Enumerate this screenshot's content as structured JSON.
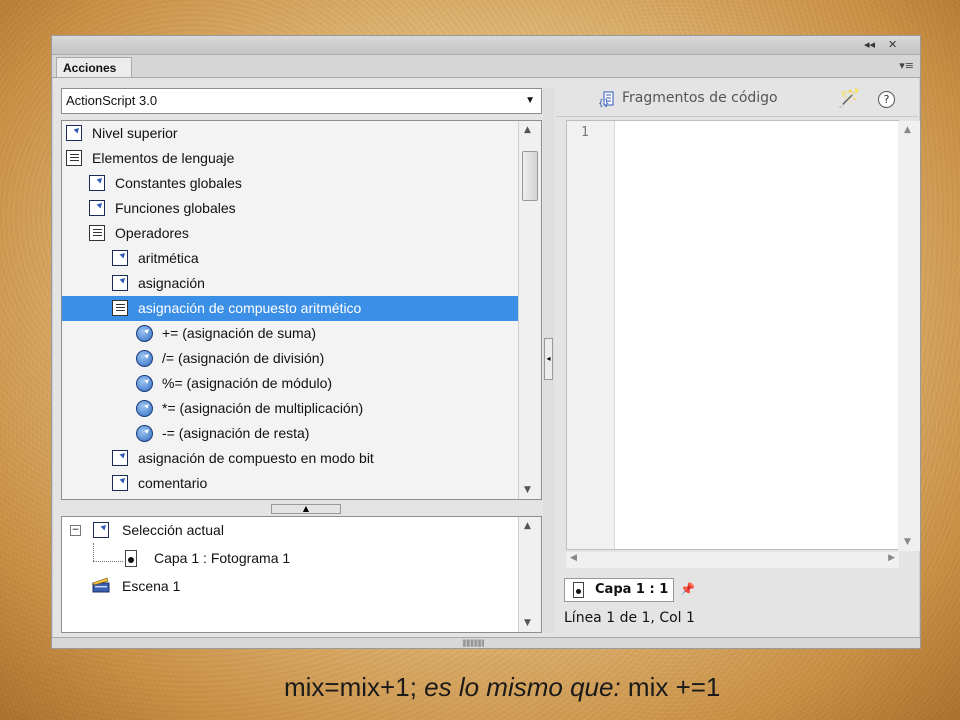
{
  "panel": {
    "tab_label": "Acciones",
    "collapse_glyph": "◂◂",
    "close_glyph": "✕",
    "menu_glyph": "▾≡"
  },
  "left": {
    "language_select": "ActionScript 3.0",
    "tree": [
      {
        "label": "Nivel superior",
        "icon": "link-icon",
        "indent": 0
      },
      {
        "label": "Elementos de lenguaje",
        "icon": "book-icon",
        "indent": 0
      },
      {
        "label": "Constantes globales",
        "icon": "link-icon",
        "indent": 1
      },
      {
        "label": "Funciones globales",
        "icon": "link-icon",
        "indent": 1
      },
      {
        "label": "Operadores",
        "icon": "book-icon",
        "indent": 1
      },
      {
        "label": "aritmética",
        "icon": "link-icon",
        "indent": 2
      },
      {
        "label": "asignación",
        "icon": "link-icon",
        "indent": 2
      },
      {
        "label": "asignación de compuesto aritmético",
        "icon": "book-icon",
        "indent": 2,
        "selected": true
      },
      {
        "label": "+= (asignación de suma)",
        "icon": "operator-icon",
        "indent": 3
      },
      {
        "label": "/= (asignación de división)",
        "icon": "operator-icon",
        "indent": 3
      },
      {
        "label": "%= (asignación de módulo)",
        "icon": "operator-icon",
        "indent": 3
      },
      {
        "label": "*= (asignación de multiplicación)",
        "icon": "operator-icon",
        "indent": 3
      },
      {
        "label": "-= (asignación de resta)",
        "icon": "operator-icon",
        "indent": 3
      },
      {
        "label": "asignación de compuesto en modo bit",
        "icon": "link-icon",
        "indent": 2
      },
      {
        "label": "comentario",
        "icon": "link-icon",
        "indent": 2
      }
    ],
    "script_nav": {
      "current_selection": "Selección actual",
      "frame": "Capa 1 : Fotograma 1",
      "scene": "Escena 1"
    }
  },
  "right": {
    "snippets_label": "Fragmentos de código",
    "help_glyph": "?",
    "line_number": "1",
    "code_tab": "Capa 1 : 1",
    "status": "Línea 1 de 1, Col 1"
  },
  "caption": {
    "part1": "mix=mix+1; ",
    "part2": "es lo mismo que:",
    "part3": " mix +=1"
  },
  "colors": {
    "selection": "#3c8fe6",
    "background": "#e6c486"
  }
}
